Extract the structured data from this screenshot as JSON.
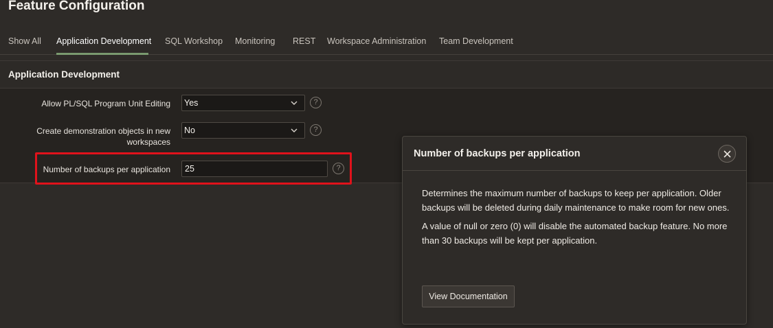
{
  "page": {
    "title": "Feature Configuration"
  },
  "tabs": [
    {
      "label": "Show All"
    },
    {
      "label": "Application Development"
    },
    {
      "label": "SQL Workshop"
    },
    {
      "label": "Monitoring"
    },
    {
      "label": "REST"
    },
    {
      "label": "Workspace Administration"
    },
    {
      "label": "Team Development"
    }
  ],
  "active_tab": "Application Development",
  "region": {
    "title": "Application Development"
  },
  "form": {
    "plsql_editing": {
      "label": "Allow PL/SQL Program Unit Editing",
      "value": "Yes"
    },
    "demo_objects": {
      "label_line1": "Create demonstration objects in new",
      "label_line2": "workspaces",
      "value": "No"
    },
    "backups": {
      "label": "Number of backups per application",
      "value": "25"
    }
  },
  "help_glyph": "?",
  "popup": {
    "title": "Number of backups per application",
    "paragraph1": "Determines the maximum number of backups to keep per application. Older backups will be deleted during daily maintenance to make room for new ones.",
    "paragraph2": "A value of null or zero (0) will disable the automated backup feature. No more than 30 backups will be kept per application.",
    "doc_button": "View Documentation"
  },
  "icons": {
    "help": "help-circle-icon",
    "close": "close-icon",
    "dropdown": "chevron-down-icon"
  },
  "colors": {
    "background": "#2e2b28",
    "region_body": "#262320",
    "active_tab_underline": "#7a9a6f",
    "highlight_border": "#e0121b"
  }
}
